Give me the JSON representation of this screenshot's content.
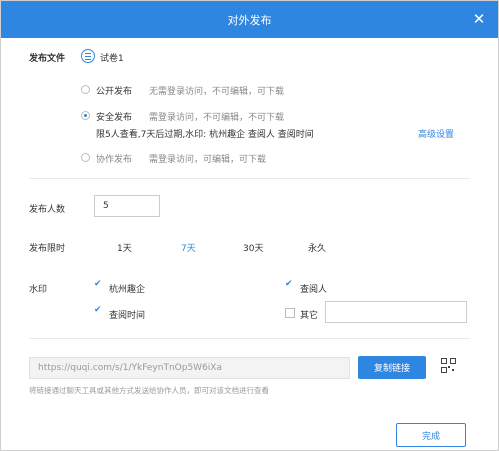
{
  "header": {
    "title": "对外发布",
    "close_icon": "close-icon"
  },
  "file": {
    "label": "发布文件",
    "name": "试卷1"
  },
  "publish_modes": [
    {
      "label": "公开发布",
      "desc": "无需登录访问，不可编辑，可下载",
      "selected": false
    },
    {
      "label": "安全发布",
      "desc": "需登录访问，不可编辑，不可下载",
      "detail": "限5人查看,7天后过期,水印: 杭州趣企 查阅人 查阅时间",
      "selected": true
    },
    {
      "label": "协作发布",
      "desc": "需登录访问，可编辑，可下载",
      "selected": false
    }
  ],
  "advanced_label": "高级设置",
  "people": {
    "label": "发布人数",
    "value": "5"
  },
  "time_limit": {
    "label": "发布限时",
    "options": [
      "1天",
      "7天",
      "30天",
      "永久"
    ],
    "selected": "7天"
  },
  "watermark": {
    "label": "水印",
    "options": [
      {
        "label": "杭州趣企",
        "checked": true
      },
      {
        "label": "查阅人",
        "checked": true
      },
      {
        "label": "查阅时间",
        "checked": true
      },
      {
        "label": "其它",
        "checked": false
      }
    ],
    "other_value": ""
  },
  "share": {
    "url": "https://quqi.com/s/1/YkFeynTnOp5W6iXa",
    "copy_label": "复制链接",
    "hint": "将链接通过聊天工具或其他方式发送给协作人员，即可对该文档进行查看"
  },
  "done_label": "完成",
  "colors": {
    "accent": "#2f86e0"
  }
}
